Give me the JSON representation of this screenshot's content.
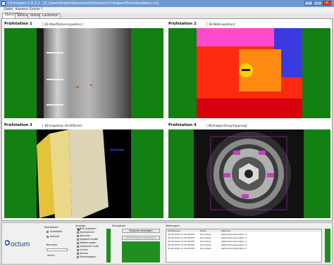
{
  "window": {
    "title": "CV-Inspect  2.8.2.2   -  [C:\\Users\\Public\\Documents\\Octum\\CV-Inspect\\Formatuebeuc.ini]",
    "buttons": [
      "–",
      "□",
      "✕"
    ]
  },
  "menu": [
    "Datei",
    "Kamera",
    "Extras",
    "?"
  ],
  "tabs": [
    {
      "label": "Übersicht",
      "active": true
    },
    {
      "label": "Kontrolle",
      "active": false
    },
    {
      "label": "Statistik",
      "active": false
    },
    {
      "label": "Laufzeiten",
      "active": false
    }
  ],
  "stations": [
    {
      "title": "Prüfstation 1",
      "subtitle": "[   2D-Oberflächeninspektion ]"
    },
    {
      "title": "Prüfstation 2",
      "subtitle": "[   3D-Wellinspektion]"
    },
    {
      "title": "Prüfstation 3",
      "subtitle": "[   3D-Inspektion Dichtfläche]"
    },
    {
      "title": "Prüfstation 4",
      "subtitle": "[   Montageprüfung Kupplung]"
    }
  ],
  "bottom": {
    "logo": "octum",
    "betriebsart": {
      "label": "Betriebsart",
      "options": [
        {
          "label": "Automatik",
          "selected": false
        },
        {
          "label": "Manuell",
          "selected": true
        }
      ],
      "benutzer_label": "Benutzer",
      "benutzer_value": "admin"
    },
    "anzeige": {
      "label": "Anzeige",
      "items": [
        {
          "label": "Bild anpassen",
          "checked": true
        },
        {
          "label": "Suchbereich",
          "checked": false
        },
        {
          "label": "Konturen",
          "checked": false
        },
        {
          "label": "Ergebnis Grafik",
          "checked": false
        },
        {
          "label": "Markierungen",
          "checked": false
        },
        {
          "label": "Gelesener Code",
          "checked": false
        },
        {
          "label": "Umriss",
          "checked": false
        },
        {
          "label": "Kanten",
          "checked": false
        },
        {
          "label": "Textausgaben",
          "checked": false
        }
      ]
    },
    "simulation": {
      "label": "Simulation",
      "button1": "Sequenz festlegen",
      "button2": "Bild Sequenz abspielen"
    },
    "meldungen": {
      "label": "Meldungen",
      "columns": [
        "Zeitstempel",
        "Modul",
        "Meldung"
      ],
      "rows": [
        [
          "05.02.2015 11:04:38.953",
          "GC.Collect",
          "Optimized Generation 2"
        ],
        [
          "05.02.2015 11:04:38.953",
          "GC.Collect",
          "Optimized Generation 2"
        ],
        [
          "05.02.2015 11:04:38.953",
          "GC.Collect",
          "Optimized Generation 2"
        ],
        [
          "05.02.2015 11:04:38.953",
          "GC.Collect",
          "Optimized Generation 2"
        ],
        [
          "05.02.2015 11:04:38.953",
          "GC.Collect",
          "Optimized Generation 2"
        ]
      ]
    }
  }
}
